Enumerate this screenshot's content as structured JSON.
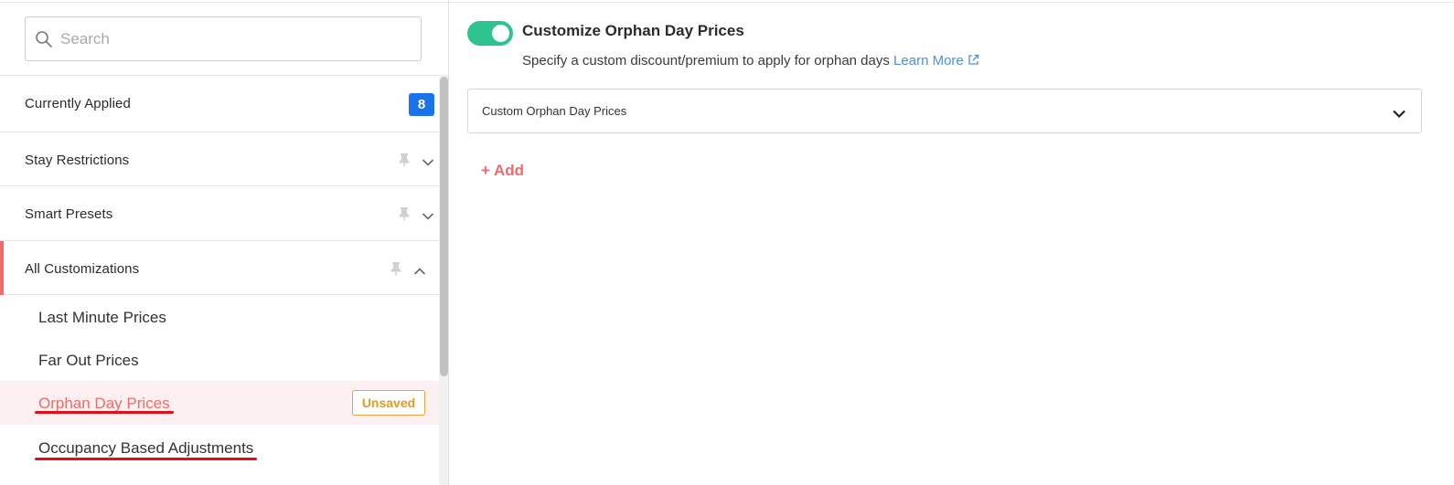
{
  "search": {
    "placeholder": "Search"
  },
  "sidebar": {
    "sections": {
      "applied": {
        "label": "Currently Applied",
        "badge": "8"
      },
      "stay": {
        "label": "Stay Restrictions"
      },
      "smart": {
        "label": "Smart Presets"
      },
      "all": {
        "label": "All Customizations"
      }
    },
    "items": [
      {
        "label": "Last Minute Prices"
      },
      {
        "label": "Far Out Prices"
      },
      {
        "label": "Orphan Day Prices",
        "status": "Unsaved"
      },
      {
        "label": "Occupancy Based Adjustments"
      }
    ]
  },
  "main": {
    "toggle_on": true,
    "title": "Customize Orphan Day Prices",
    "description": "Specify a custom discount/premium to apply for orphan days",
    "learn_more": "Learn More",
    "dropdown_label": "Custom Orphan Day Prices",
    "add_label": "+ Add"
  },
  "colors": {
    "accent_red": "#ef6b6b",
    "toggle_green": "#2ec38e",
    "badge_blue": "#1a73e8",
    "link_blue": "#4a90e2",
    "unsaved_orange": "#e29a22",
    "annotation_underline": "#e0101a"
  },
  "icons": [
    "search-icon",
    "pin-icon",
    "chevron-down-icon",
    "chevron-up-icon",
    "external-link-icon"
  ]
}
